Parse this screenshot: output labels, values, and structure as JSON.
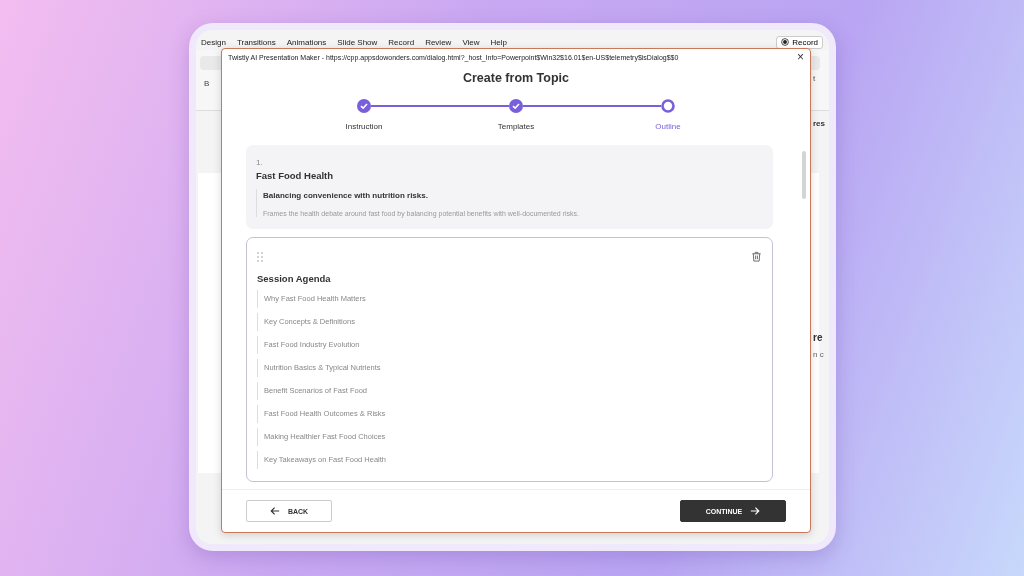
{
  "app": {
    "menu": [
      "Design",
      "Transitions",
      "Animations",
      "Slide Show",
      "Record",
      "Review",
      "View",
      "Help"
    ],
    "record_button": "Record",
    "ribbon_letter": "B",
    "behind_texts": [
      "t",
      "res",
      "re",
      "n c"
    ]
  },
  "dialog": {
    "title": "Twistly AI Presentation Maker - https://cpp.appsdowonders.com/dialog.html?_host_Info=Powerpoint$Win32$16.01$en-US$telemetry$isDialog$$0",
    "close": "×",
    "heading": "Create from Topic",
    "steps": [
      {
        "label": "Instruction",
        "completed": true,
        "selected": false
      },
      {
        "label": "Templates",
        "completed": true,
        "selected": false
      },
      {
        "label": "Outline",
        "completed": false,
        "selected": true
      }
    ],
    "sections": [
      {
        "kind": "summary",
        "selected": false,
        "number": "1.",
        "title": "Fast Food Health",
        "subtitle": "Balancing convenience with nutrition risks.",
        "description": "Frames the health debate around fast food by balancing potential benefits with well-documented risks."
      },
      {
        "kind": "list",
        "selected": true,
        "title": "Session Agenda",
        "items": [
          "Why Fast Food Health Matters",
          "Key Concepts & Definitions",
          "Fast Food Industry Evolution",
          "Nutrition Basics & Typical Nutrients",
          "Benefit Scenarios of Fast Food",
          "Fast Food Health Outcomes & Risks",
          "Making Healthier Fast Food Choices",
          "Key Takeaways on Fast Food Health"
        ]
      }
    ],
    "back_button": "BACK",
    "continue_button": "CONTINUE"
  }
}
